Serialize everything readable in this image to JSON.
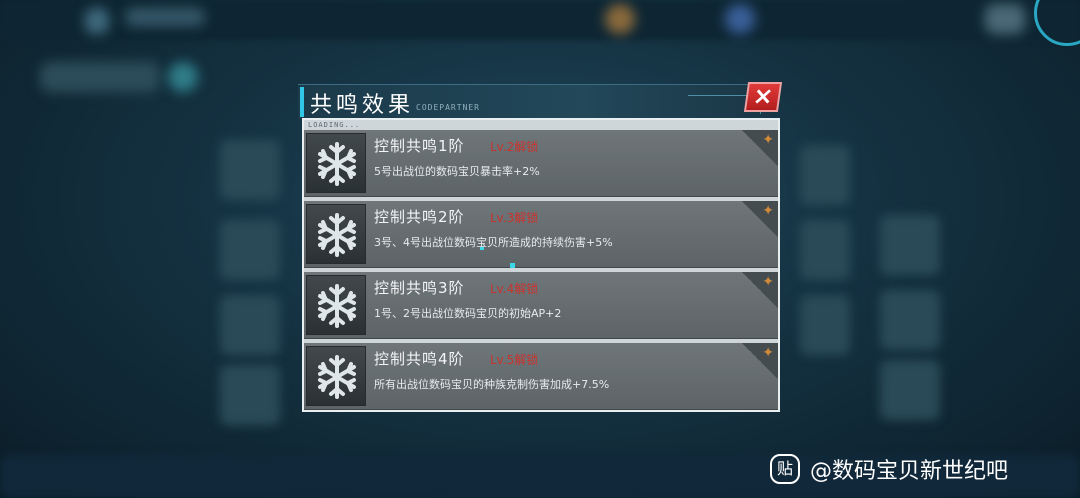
{
  "dialog": {
    "title": "共鸣效果",
    "title_deco": "CODEPARTNER",
    "loading_text": "LOADING...",
    "close_label": "×"
  },
  "rows": [
    {
      "title": "控制共鸣1阶",
      "unlock": "Lv.2解锁",
      "desc": "5号出战位的数码宝贝暴击率+2%"
    },
    {
      "title": "控制共鸣2阶",
      "unlock": "Lv.3解锁",
      "desc": "3号、4号出战位数码宝贝所造成的持续伤害+5%"
    },
    {
      "title": "控制共鸣3阶",
      "unlock": "Lv.4解锁",
      "desc": "1号、2号出战位数码宝贝的初始AP+2"
    },
    {
      "title": "控制共鸣4阶",
      "unlock": "Lv.5解锁",
      "desc": "所有出战位数码宝贝的种族克制伤害加成+7.5%"
    }
  ],
  "icons": {
    "row_icon": "snowflake-icon",
    "corner_icon": "rank-badge-icon",
    "close_icon": "close-icon",
    "watermark_icon": "tieba-icon"
  },
  "colors": {
    "accent": "#31c6e6",
    "unlock_text": "#c9332e",
    "close": "#d42a2a"
  },
  "watermark": {
    "icon_glyph": "贴",
    "text": "@数码宝贝新世纪吧"
  }
}
